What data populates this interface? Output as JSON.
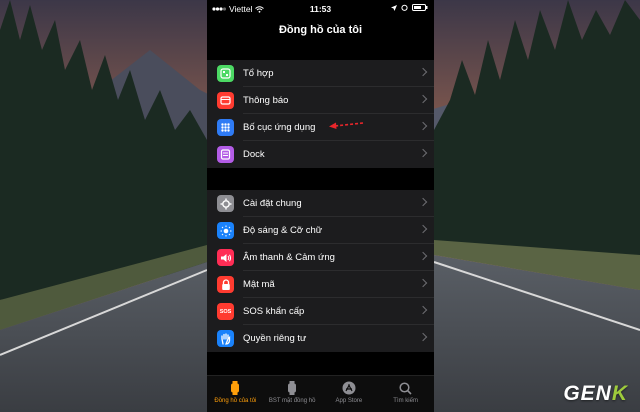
{
  "status_bar": {
    "carrier": "Viettel",
    "time": "11:53"
  },
  "header": {
    "title": "Đồng hồ của tôi"
  },
  "section1": [
    {
      "label": "Tổ hợp",
      "icon": "watch-face-icon",
      "color": "#4cd964"
    },
    {
      "label": "Thông báo",
      "icon": "notifications-icon",
      "color": "#ff3b30"
    },
    {
      "label": "Bố cục ứng dụng",
      "icon": "app-grid-icon",
      "color": "#2f7bf5"
    },
    {
      "label": "Dock",
      "icon": "dock-icon",
      "color": "#b35ce6"
    }
  ],
  "section2": [
    {
      "label": "Cài đặt chung",
      "icon": "gear-icon",
      "color": "#8e8e93"
    },
    {
      "label": "Độ sáng & Cỡ chữ",
      "icon": "brightness-icon",
      "color": "#1a82fb"
    },
    {
      "label": "Âm thanh & Cảm ứng",
      "icon": "speaker-icon",
      "color": "#ff2d55"
    },
    {
      "label": "Mật mã",
      "icon": "lock-icon",
      "color": "#ff3b30"
    },
    {
      "label": "SOS khẩn cấp",
      "icon": "sos-icon",
      "color": "#ff3b30",
      "icon_text": "SOS"
    },
    {
      "label": "Quyền riêng tư",
      "icon": "hand-icon",
      "color": "#1a82fb"
    }
  ],
  "tabs": [
    {
      "label": "Đồng hồ của tôi",
      "icon": "watch-icon",
      "active": true
    },
    {
      "label": "BST mặt đồng hồ",
      "icon": "face-gallery-icon",
      "active": false
    },
    {
      "label": "App Store",
      "icon": "app-store-icon",
      "active": false
    },
    {
      "label": "Tìm kiếm",
      "icon": "search-icon",
      "active": false
    }
  ],
  "watermark": {
    "text_main": "GEN",
    "text_accent": "K"
  },
  "colors": {
    "accent": "#ff9f0a",
    "annotation_arrow": "#e8262b"
  }
}
